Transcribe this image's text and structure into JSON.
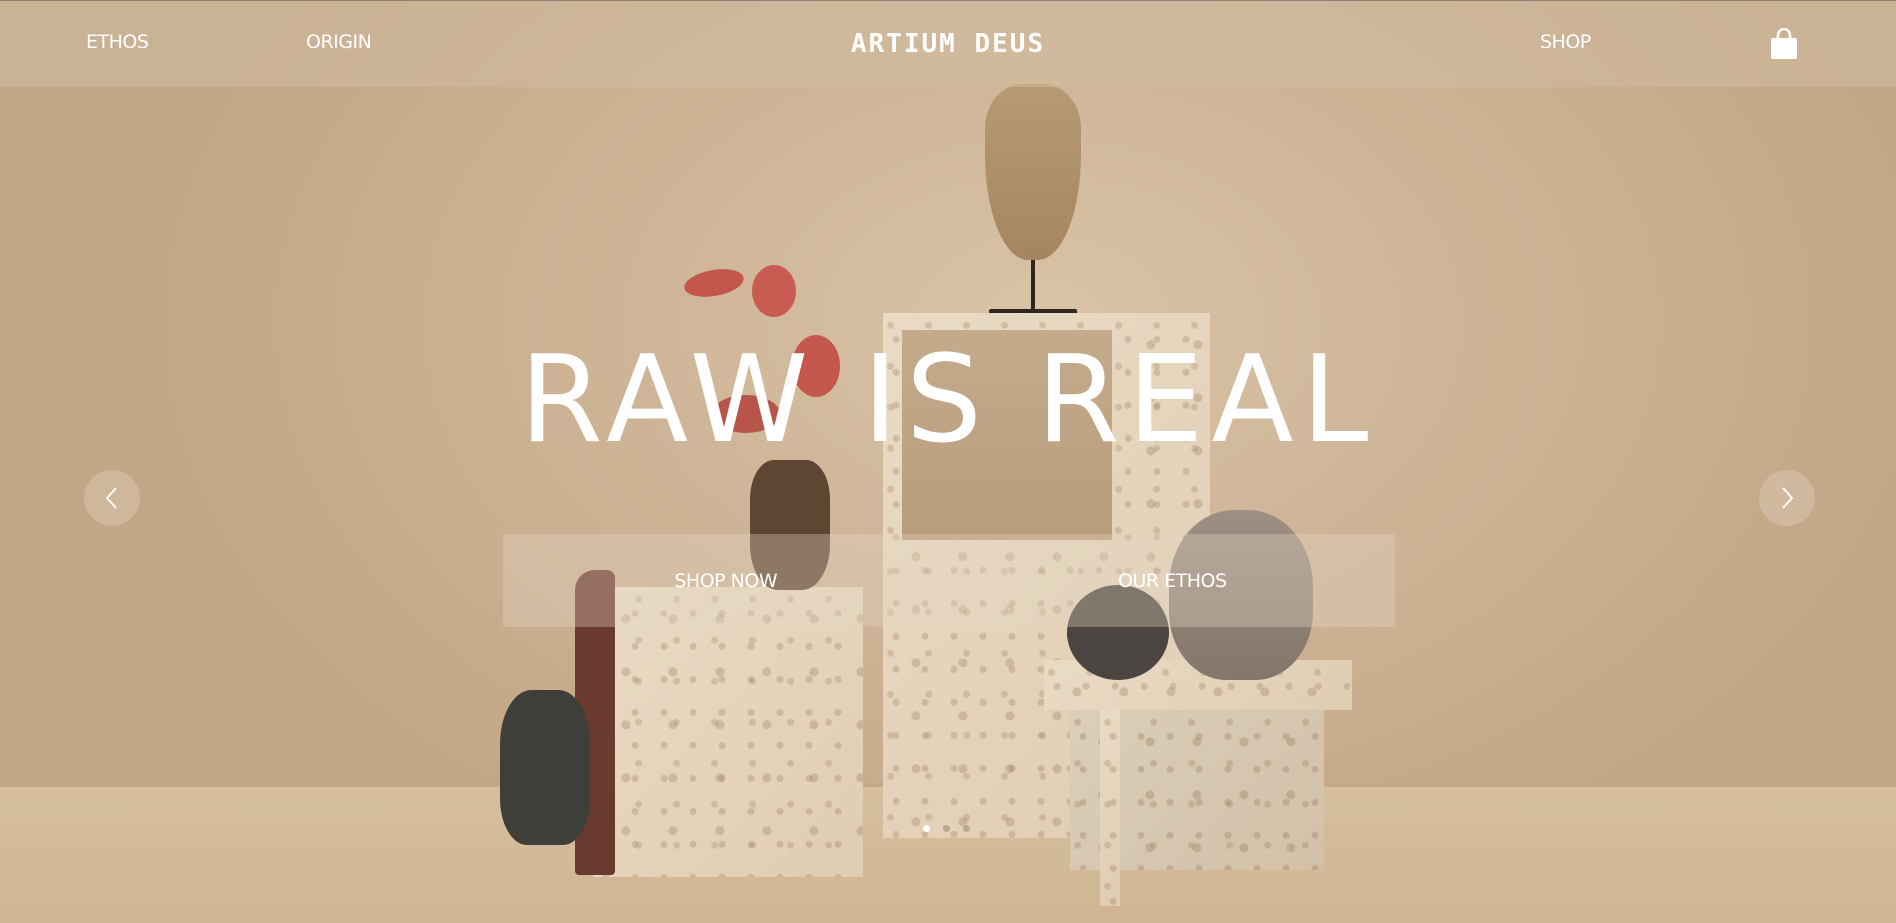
{
  "header": {
    "nav_left": [
      {
        "label": "ETHOS"
      },
      {
        "label": "ORIGIN"
      }
    ],
    "brand": "ARTIUM DEUS",
    "nav_right": [
      {
        "label": "SHOP"
      }
    ],
    "cart_icon": "shopping-bag-icon"
  },
  "hero": {
    "headline": "RAW IS REAL",
    "buttons": [
      {
        "label": "SHOP NOW"
      },
      {
        "label": "OUR ETHOS"
      }
    ],
    "prev_icon": "chevron-left-icon",
    "next_icon": "chevron-right-icon",
    "slides_total": 3,
    "active_slide": 1
  },
  "colors": {
    "text": "#ffffff",
    "wall": "#cfb597",
    "dot_active": "#ffffff",
    "dot_inactive": "#b8a88f"
  }
}
